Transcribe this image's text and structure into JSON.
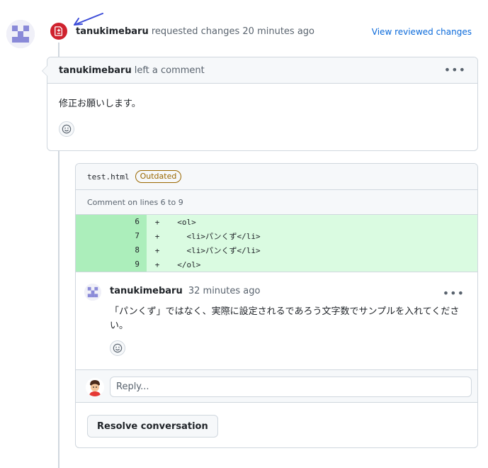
{
  "colors": {
    "danger": "#cf222e",
    "link": "#0969da",
    "attention": "#9a6700",
    "diff_add_bg": "#dafbe1",
    "diff_add_num_bg": "#aceebb",
    "annotation_arrow": "#3c4cd8"
  },
  "icons": {
    "review_event": "file-diff-icon",
    "annotation": "arrow-icon",
    "menu": "kebab-horizontal-icon",
    "reaction": "smiley-icon"
  },
  "review_event": {
    "author": "tanukimebaru",
    "action": "requested changes 20 minutes ago",
    "view_link": "View reviewed changes"
  },
  "review_comment": {
    "author": "tanukimebaru",
    "action": "left a comment",
    "body": "修正お願いします。"
  },
  "thread": {
    "file_name": "test.html",
    "badge": "Outdated",
    "lines_caption": "Comment on lines 6 to 9",
    "diff_lines": [
      {
        "num": "6",
        "sign": "+",
        "code": "  <ol>"
      },
      {
        "num": "7",
        "sign": "+",
        "code": "    <li>パンくず</li>"
      },
      {
        "num": "8",
        "sign": "+",
        "code": "    <li>パンくず</li>"
      },
      {
        "num": "9",
        "sign": "+",
        "code": "  </ol>"
      }
    ],
    "comment": {
      "author": "tanukimebaru",
      "time": "32 minutes ago",
      "body": "「パンくず」ではなく、実際に設定されるであろう文字数でサンプルを入れてください。"
    },
    "reply_placeholder": "Reply...",
    "resolve_label": "Resolve conversation"
  }
}
